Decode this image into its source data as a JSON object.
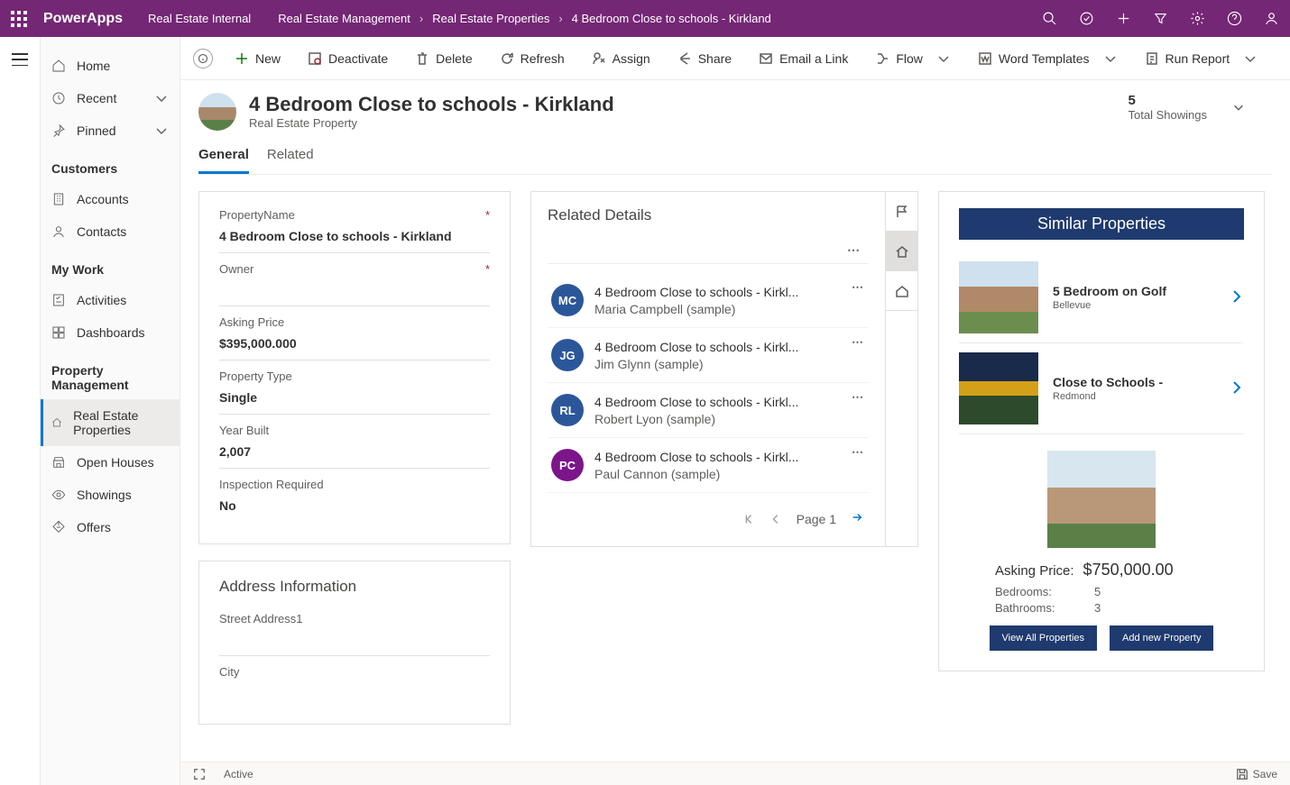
{
  "topbar": {
    "app": "PowerApps",
    "env": "Real Estate Internal",
    "breadcrumbs": [
      "Real Estate Management",
      "Real Estate Properties",
      "4 Bedroom Close to schools - Kirkland"
    ]
  },
  "sidebar": {
    "home": "Home",
    "recent": "Recent",
    "pinned": "Pinned",
    "groups": [
      {
        "head": "Customers",
        "items": [
          {
            "label": "Accounts",
            "icon": "accounts"
          },
          {
            "label": "Contacts",
            "icon": "contact"
          }
        ]
      },
      {
        "head": "My Work",
        "items": [
          {
            "label": "Activities",
            "icon": "activity"
          },
          {
            "label": "Dashboards",
            "icon": "dashboard"
          }
        ]
      },
      {
        "head": "Property Management",
        "items": [
          {
            "label": "Real Estate Properties",
            "icon": "house",
            "selected": true
          },
          {
            "label": "Open Houses",
            "icon": "openhouse"
          },
          {
            "label": "Showings",
            "icon": "showing"
          },
          {
            "label": "Offers",
            "icon": "offer"
          }
        ]
      }
    ]
  },
  "commands": {
    "new": "New",
    "deactivate": "Deactivate",
    "delete": "Delete",
    "refresh": "Refresh",
    "assign": "Assign",
    "share": "Share",
    "emaillink": "Email a Link",
    "flow": "Flow",
    "wordtpl": "Word Templates",
    "runreport": "Run Report"
  },
  "record": {
    "title": "4 Bedroom Close to schools - Kirkland",
    "subtitle": "Real Estate Property",
    "stat_value": "5",
    "stat_label": "Total Showings",
    "tabs": [
      "General",
      "Related"
    ]
  },
  "fields": {
    "propname_label": "PropertyName",
    "propname_value": "4 Bedroom Close to schools - Kirkland",
    "owner_label": "Owner",
    "owner_value": "",
    "price_label": "Asking Price",
    "price_value": "$395,000.000",
    "type_label": "Property Type",
    "type_value": "Single",
    "year_label": "Year Built",
    "year_value": "2,007",
    "insp_label": "Inspection Required",
    "insp_value": "No"
  },
  "address": {
    "section": "Address Information",
    "street_label": "Street Address1",
    "city_label": "City"
  },
  "related": {
    "title": "Related Details",
    "rows": [
      {
        "initials": "MC",
        "color": "#2b579a",
        "t1": "4 Bedroom Close to schools - Kirkl...",
        "t2": "Maria Campbell (sample)"
      },
      {
        "initials": "JG",
        "color": "#2b579a",
        "t1": "4 Bedroom Close to schools - Kirkl...",
        "t2": "Jim Glynn (sample)"
      },
      {
        "initials": "RL",
        "color": "#2b579a",
        "t1": "4 Bedroom Close to schools - Kirkl...",
        "t2": "Robert Lyon (sample)"
      },
      {
        "initials": "PC",
        "color": "#7c158a",
        "t1": "4 Bedroom Close to schools - Kirkl...",
        "t2": "Paul Cannon (sample)"
      }
    ],
    "page": "Page 1"
  },
  "similar": {
    "title": "Similar Properties",
    "rows": [
      {
        "t1": "5 Bedroom on Golf",
        "t2": "Bellevue"
      },
      {
        "t1": "Close to Schools -",
        "t2": "Redmond"
      }
    ],
    "asking_label": "Asking Price:",
    "asking_value": "$750,000.00",
    "bed_label": "Bedrooms:",
    "bed_value": "5",
    "bath_label": "Bathrooms:",
    "bath_value": "3",
    "btn_viewall": "View All Properties",
    "btn_addnew": "Add new Property"
  },
  "footer": {
    "status": "Active",
    "save": "Save"
  }
}
